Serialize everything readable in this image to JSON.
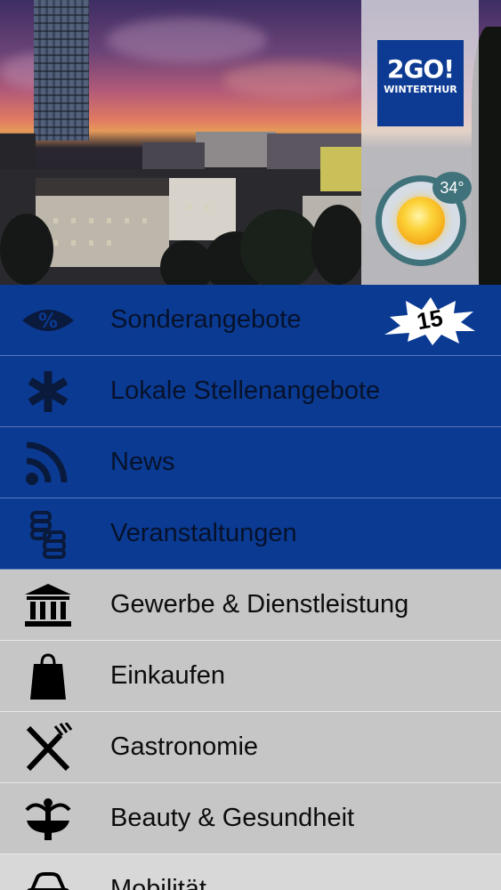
{
  "hero": {
    "logo": {
      "line1": "2GO!",
      "line2": "WINTERTHUR"
    },
    "weather": {
      "temperature": "34°",
      "condition_icon": "sun-icon"
    }
  },
  "menu": {
    "items": [
      {
        "label": "Sonderangebote",
        "icon": "percent-tag-icon",
        "style": "blue",
        "badge": "15"
      },
      {
        "label": "Lokale Stellenangebote",
        "icon": "asterisk-icon",
        "style": "blue"
      },
      {
        "label": "News",
        "icon": "rss-icon",
        "style": "blue"
      },
      {
        "label": "Veranstaltungen",
        "icon": "events-icon",
        "style": "blue"
      },
      {
        "label": "Gewerbe & Dienstleistung",
        "icon": "building-icon",
        "style": "grey"
      },
      {
        "label": "Einkaufen",
        "icon": "shopping-bag-icon",
        "style": "grey"
      },
      {
        "label": "Gastronomie",
        "icon": "fork-knife-icon",
        "style": "grey"
      },
      {
        "label": "Beauty & Gesundheit",
        "icon": "fountain-icon",
        "style": "grey"
      },
      {
        "label": "Mobilität",
        "icon": "car-icon",
        "style": "light"
      }
    ]
  },
  "colors": {
    "brand_blue": "#0b3a93",
    "menu_grey": "#c6c6c6",
    "weather_teal": "#3f727a"
  }
}
